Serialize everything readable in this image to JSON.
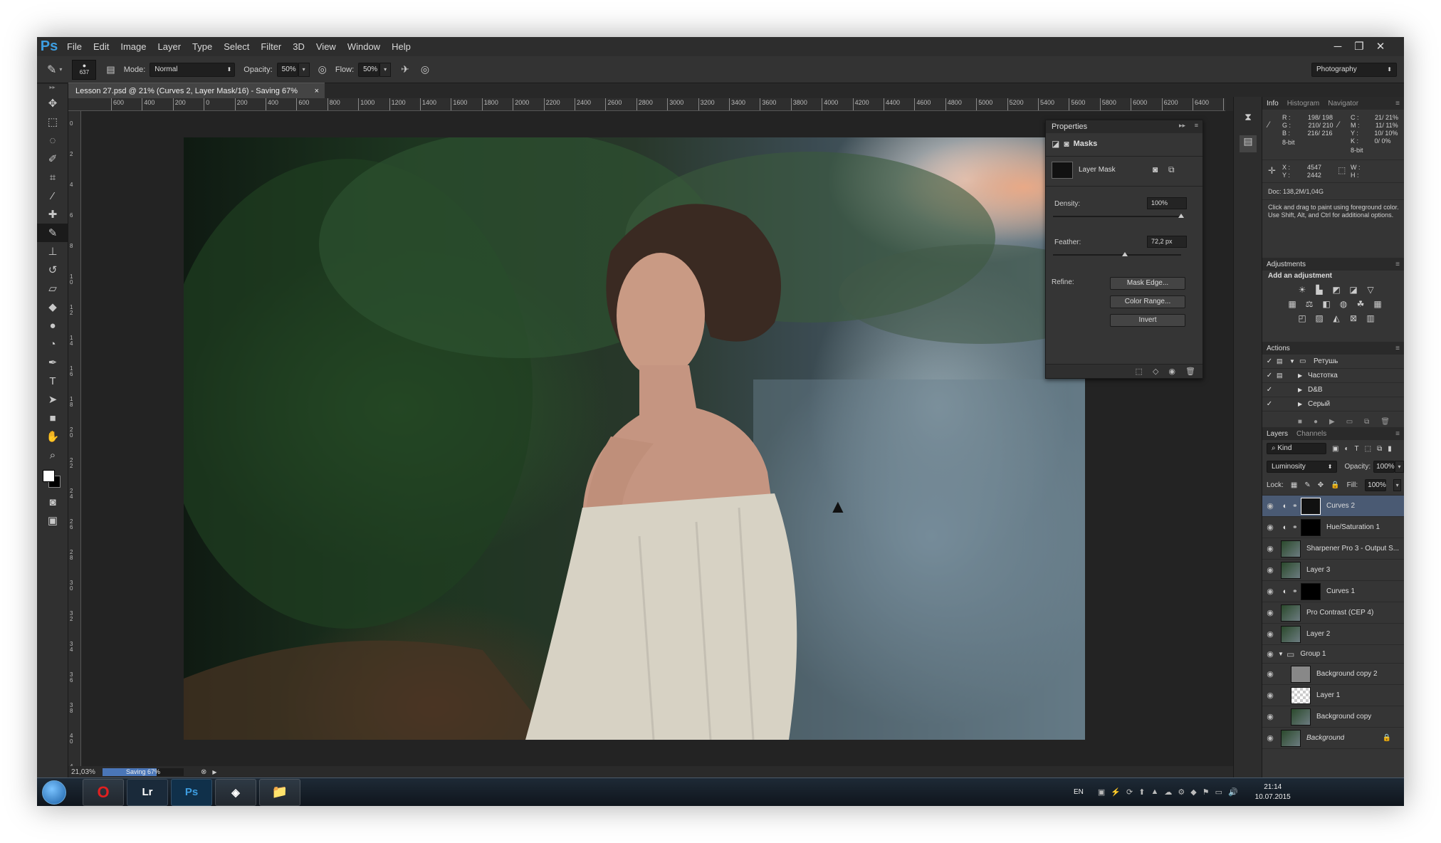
{
  "app": {
    "logo": "Ps"
  },
  "menu": [
    "File",
    "Edit",
    "Image",
    "Layer",
    "Type",
    "Select",
    "Filter",
    "3D",
    "View",
    "Window",
    "Help"
  ],
  "window_controls": {
    "minimize": "─",
    "restore": "❐",
    "close": "✕"
  },
  "options": {
    "brush_size": "637",
    "mode_label": "Mode:",
    "mode_value": "Normal",
    "opacity_label": "Opacity:",
    "opacity_value": "50%",
    "flow_label": "Flow:",
    "flow_value": "50%",
    "workspace": "Photography"
  },
  "document": {
    "tab_title": "Lesson 27.psd @ 21% (Curves 2, Layer Mask/16) - Saving 67%",
    "tab_close": "×",
    "ruler_top": [
      "600",
      "400",
      "200",
      "0",
      "200",
      "400",
      "600",
      "800",
      "1000",
      "1200",
      "1400",
      "1600",
      "1800",
      "2000",
      "2200",
      "2400",
      "2600",
      "2800",
      "3000",
      "3200",
      "3400",
      "3600",
      "3800",
      "4000",
      "4200",
      "4400",
      "4600",
      "4800",
      "5000",
      "5200",
      "5400",
      "5600",
      "5800",
      "6000",
      "6200",
      "6400",
      "6600"
    ],
    "ruler_left": [
      "0",
      "2",
      "4",
      "6",
      "8",
      "1 0",
      "1 2",
      "1 4",
      "1 6",
      "1 8",
      "2 0",
      "2 2",
      "2 4",
      "2 6",
      "2 8",
      "3 0",
      "3 2",
      "3 4",
      "3 6",
      "3 8",
      "4 0",
      "4 2"
    ]
  },
  "properties": {
    "title": "Properties",
    "section": "Masks",
    "mask_label": "Layer Mask",
    "density_label": "Density:",
    "density_value": "100%",
    "density_level": 1.0,
    "feather_label": "Feather:",
    "feather_value": "72,2 px",
    "feather_level": 0.56,
    "refine_label": "Refine:",
    "buttons": [
      "Mask Edge...",
      "Color Range...",
      "Invert"
    ]
  },
  "info": {
    "tabs": [
      "Info",
      "Histogram",
      "Navigator"
    ],
    "rgb": {
      "R": "198/ 198",
      "G": "210/ 210",
      "B": "216/ 216"
    },
    "cmyk": {
      "C": "21/ 21%",
      "M": "11/ 11%",
      "Y": "10/ 10%",
      "K": "0/ 0%"
    },
    "bit_left": "8-bit",
    "bit_right": "8-bit",
    "x_label": "X :",
    "x_value": "4547",
    "y_label": "Y :",
    "y_value": "2442",
    "w_label": "W :",
    "h_label": "H :",
    "doc": "Doc: 138,2M/1,04G",
    "hint": "Click and drag to paint using foreground color. Use Shift, Alt, and Ctrl for additional options."
  },
  "adjustments": {
    "title": "Adjustments",
    "subtitle": "Add an adjustment"
  },
  "actions": {
    "title": "Actions",
    "items": [
      "Ретушь",
      "Частотка",
      "D&B",
      "Серый"
    ]
  },
  "layers": {
    "tabs": [
      "Layers",
      "Channels"
    ],
    "kind": "Kind",
    "blend": "Luminosity",
    "opacity_label": "Opacity:",
    "opacity_value": "100%",
    "lock_label": "Lock:",
    "fill_label": "Fill:",
    "fill_value": "100%",
    "items": [
      {
        "name": "Curves 2",
        "type": "adj",
        "thumb": "mask-photo",
        "selected": true
      },
      {
        "name": "Hue/Saturation 1",
        "type": "adj",
        "thumb": "mask"
      },
      {
        "name": "Sharpener Pro 3 - Output S...",
        "type": "pixel",
        "thumb": "photo"
      },
      {
        "name": "Layer 3",
        "type": "pixel",
        "thumb": "photo"
      },
      {
        "name": "Curves 1",
        "type": "adj",
        "thumb": "mask"
      },
      {
        "name": "Pro Contrast (CEP 4)",
        "type": "pixel",
        "thumb": "photo"
      },
      {
        "name": "Layer 2",
        "type": "pixel",
        "thumb": "photo"
      },
      {
        "name": "Group 1",
        "type": "group",
        "thumb": "folder"
      },
      {
        "name": "Background copy 2",
        "type": "pixel",
        "thumb": "gray",
        "indent": true
      },
      {
        "name": "Layer 1",
        "type": "pixel",
        "thumb": "checker",
        "indent": true
      },
      {
        "name": "Background copy",
        "type": "pixel",
        "thumb": "photo",
        "indent": true
      },
      {
        "name": "Background",
        "type": "pixel",
        "thumb": "photo",
        "locked": true,
        "italic": true
      }
    ]
  },
  "status": {
    "zoom": "21,03%",
    "progress_label": "Saving 67%",
    "progress": 0.67
  },
  "taskbar": {
    "apps": [
      "O",
      "Lr",
      "Ps",
      "◈",
      "📁"
    ],
    "lang": "EN",
    "time": "21:14",
    "date": "10.07.2015"
  },
  "colors": {
    "accent": "#3d9de0",
    "selected_layer": "#4a5a73"
  }
}
